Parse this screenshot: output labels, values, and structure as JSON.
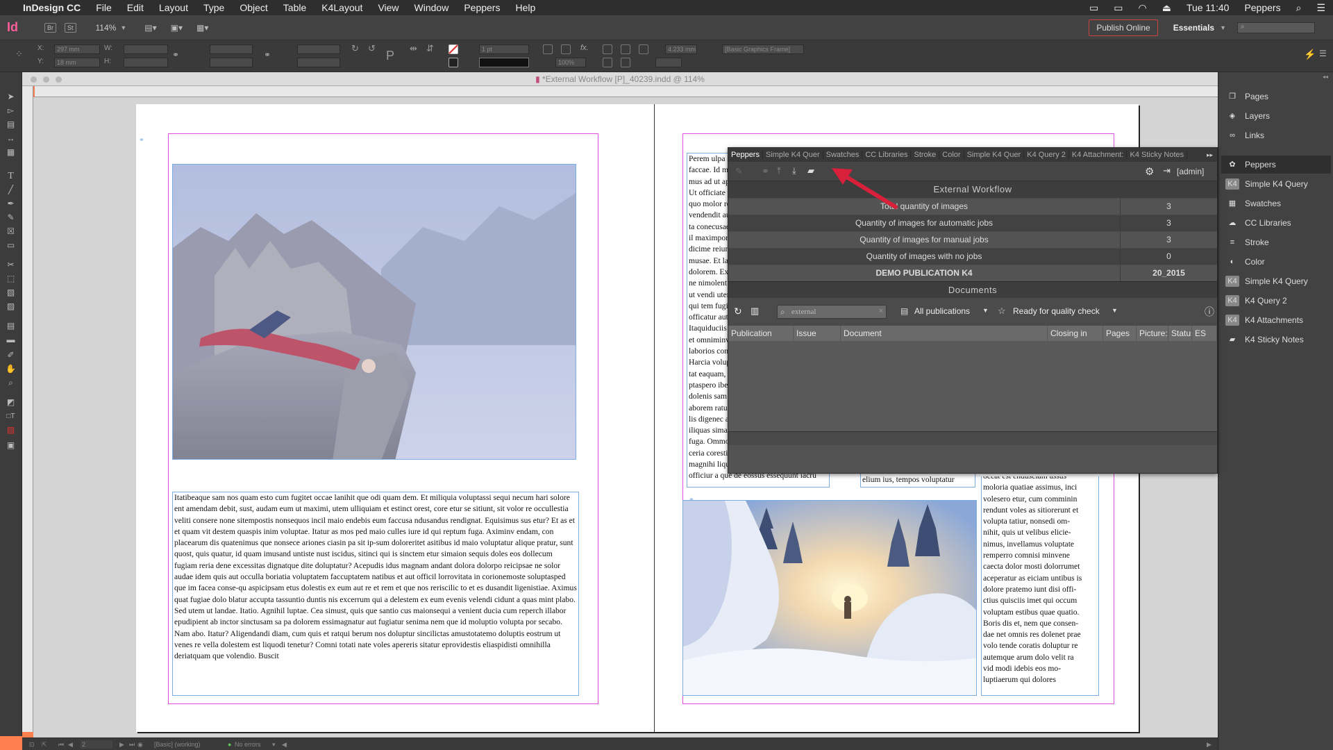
{
  "menubar": {
    "app_name": "InDesign CC",
    "items": [
      "File",
      "Edit",
      "Layout",
      "Type",
      "Object",
      "Table",
      "K4Layout",
      "View",
      "Window",
      "Peppers",
      "Help"
    ],
    "clock": "Tue 11:40",
    "user": "Peppers"
  },
  "appbar": {
    "logo": "Id",
    "bridge": "Br",
    "stock": "St",
    "zoom": "114%",
    "publish_label": "Publish Online",
    "workspace": "Essentials"
  },
  "control": {
    "x_label": "X:",
    "x_value": "297 mm",
    "y_label": "Y:",
    "y_value": "18 mm",
    "w_label": "W:",
    "h_label": "H:",
    "stroke_weight": "1 pt",
    "opacity": "100%",
    "offset": "4.233 mm",
    "object_style": "[Basic Graphics Frame]"
  },
  "document": {
    "title": "*External Workflow [P]_40239.indd @ 114%",
    "left_text": "Itatibeaque sam nos quam esto cum fugitet occae lanihit que odi quam dem. Et miliquia voluptassi sequi necum hari solore ent amendam debit, sust, audam eum ut maximi, utem ulliquiam et estinct orest, core etur se sitiunt, sit volor re occullestia veliti consere none sitempostis nonsequos incil maio endebis eum faccusa ndusandus rendignat. Equisimus sus etur? Et as et et quam vit destem quaspis inim voluptae. Itatur as mos ped maio culles iure id qui reptum fuga. Aximinv endam, con placearum dis quatenimus que nonsece ariones ciasin pa sit ip-sum doloreritet asitibus id maio voluptatur alique pratur, sunt quost, quis quatur, id quam imusand untiste nust iscidus, sitinci qui is sinctem etur simaion sequis doles eos dollecum fugiam reria dene excessitas dignatque dite doluptatur? Acepudis idus magnam andant dolora dolorpo reicipsae ne solor audae idem quis aut occulla boriatia voluptatem faccuptatem natibus et aut officil lorrovitata in corionemoste soluptasped que im facea conse-qu aspicipsam etus dolestis ex eum aut re et rem et que nos reriscilic to et es dusandit ligenistiae. Aximus quat fugiae dolo blatur accupta tassuntio duntis nis excerrum qui a delestem ex eum evenis velendi cidunt a quas mint plabo. Sed utem ut landae. Itatio. Agnihil luptae. Cea simust, quis que santio cus maionsequi a venient ducia cum reperch illabor epudipient ab inctor sinctusam sa pa dolorem essimagnatur aut fugiatur senima nem que id moluptio volupta por secabo. Nam abo. Itatur? Aligendandi diam, cum quis et ratqui berum nos doluptur sincilictas amustotatemo doluptis eostrum ut venes re vella dolestem est liquodi tenetur? Comni totati nate voles apereris sitatur eprovidestis eliaspidisti omnihilla deriatquam que volendio. Buscit",
    "right_col1": "Perem ulpa sectae n\nfaccae. Id maxim si\nmus ad ut apidignat\nUt officiate que nam\nquo molor re sim ni\nvendendit aut evelig\nta conecusae. Bitis p\nil maximpore prati a\ndicime reiundentis e\nmusae. Et lab iur sa\ndolorem. Ex et re ip\nne nimolent lique n\nut vendi utendunda\nqui tem fugiatis per\nofficatur aut ab inct\nItaquiduciis explabo\net omniminverum s\nlaborios consent.\nHarcia voluptae vol\ntat eaquam, nem lar\nptaspero ibeaqui te r\ndolenis sam ad quat\naborem ratur as volu\nlis digenec aborese r\niliquas simagni mol\nfuga. Ommos estior\nceria coresti nis es a\nmagnihi liquia vello\nofficiur a que de eossus essequunt iacru",
    "right_col2": "elium ius, tempos voluptatur",
    "right_col3": "occat est endusciam assus\nmoloria quatiae assimus, inci\nvolesero etur, cum comminin\nrendunt voles as sitiorerunt et\nvolupta tatiur, nonsedi om-\nnihit, quis ut velibus elicie-\nnimus, invellamus voluptate\nremperro comnisi minvene\ncaecta dolor mosti dolorrumet\naceperatur as eiciam untibus is\ndolore pratemo iunt disi offi-\nctius quisciis imet qui occum\nvoluptam estibus quae quatio.\nBoris dis et, nem que consen-\ndae net omnis res dolenet prae\nvolo tende coratis doluptur re\nautemque arum dolo velit ra\nvid modi idebis eos mo-\nluptiaerum qui dolores"
  },
  "status": {
    "page": "2",
    "style": "[Basic] (working)",
    "errors": "No errors"
  },
  "dock": {
    "group1": [
      "Pages",
      "Layers",
      "Links"
    ],
    "group2": [
      "Peppers",
      "Simple K4 Query",
      "Swatches",
      "CC Libraries",
      "Stroke",
      "Color",
      "Simple K4 Query",
      "K4 Query  2",
      "K4 Attachments",
      "K4 Sticky Notes"
    ]
  },
  "peppers": {
    "tabs": [
      "Peppers",
      "Simple K4 Quer",
      "Swatches",
      "CC Libraries",
      "Stroke",
      "Color",
      "Simple K4 Quer",
      "K4 Query  2",
      "K4 Attachment:",
      "K4 Sticky Notes"
    ],
    "user": "[admin]",
    "section1_title": "External Workflow",
    "stats": [
      {
        "label": "Total quantity of images",
        "value": "3"
      },
      {
        "label": "Quantity of images for automatic jobs",
        "value": "3"
      },
      {
        "label": "Quantity of images for manual jobs",
        "value": "3"
      },
      {
        "label": "Quantity of images with no jobs",
        "value": "0"
      }
    ],
    "publication_row": {
      "label": "DEMO PUBLICATION K4",
      "value": "20_2015"
    },
    "section2_title": "Documents",
    "search_value": "external",
    "publications_filter": "All publications",
    "status_filter": "Ready for quality check",
    "columns": [
      "Publication",
      "Issue",
      "Document",
      "Closing in",
      "Pages",
      "Picture:",
      "Status",
      "ES"
    ]
  },
  "colors": {
    "accent": "#ff7e4f",
    "arrow": "#d8203a",
    "margin_guide": "#e04ee0",
    "frame_edge": "#7aaee0"
  }
}
